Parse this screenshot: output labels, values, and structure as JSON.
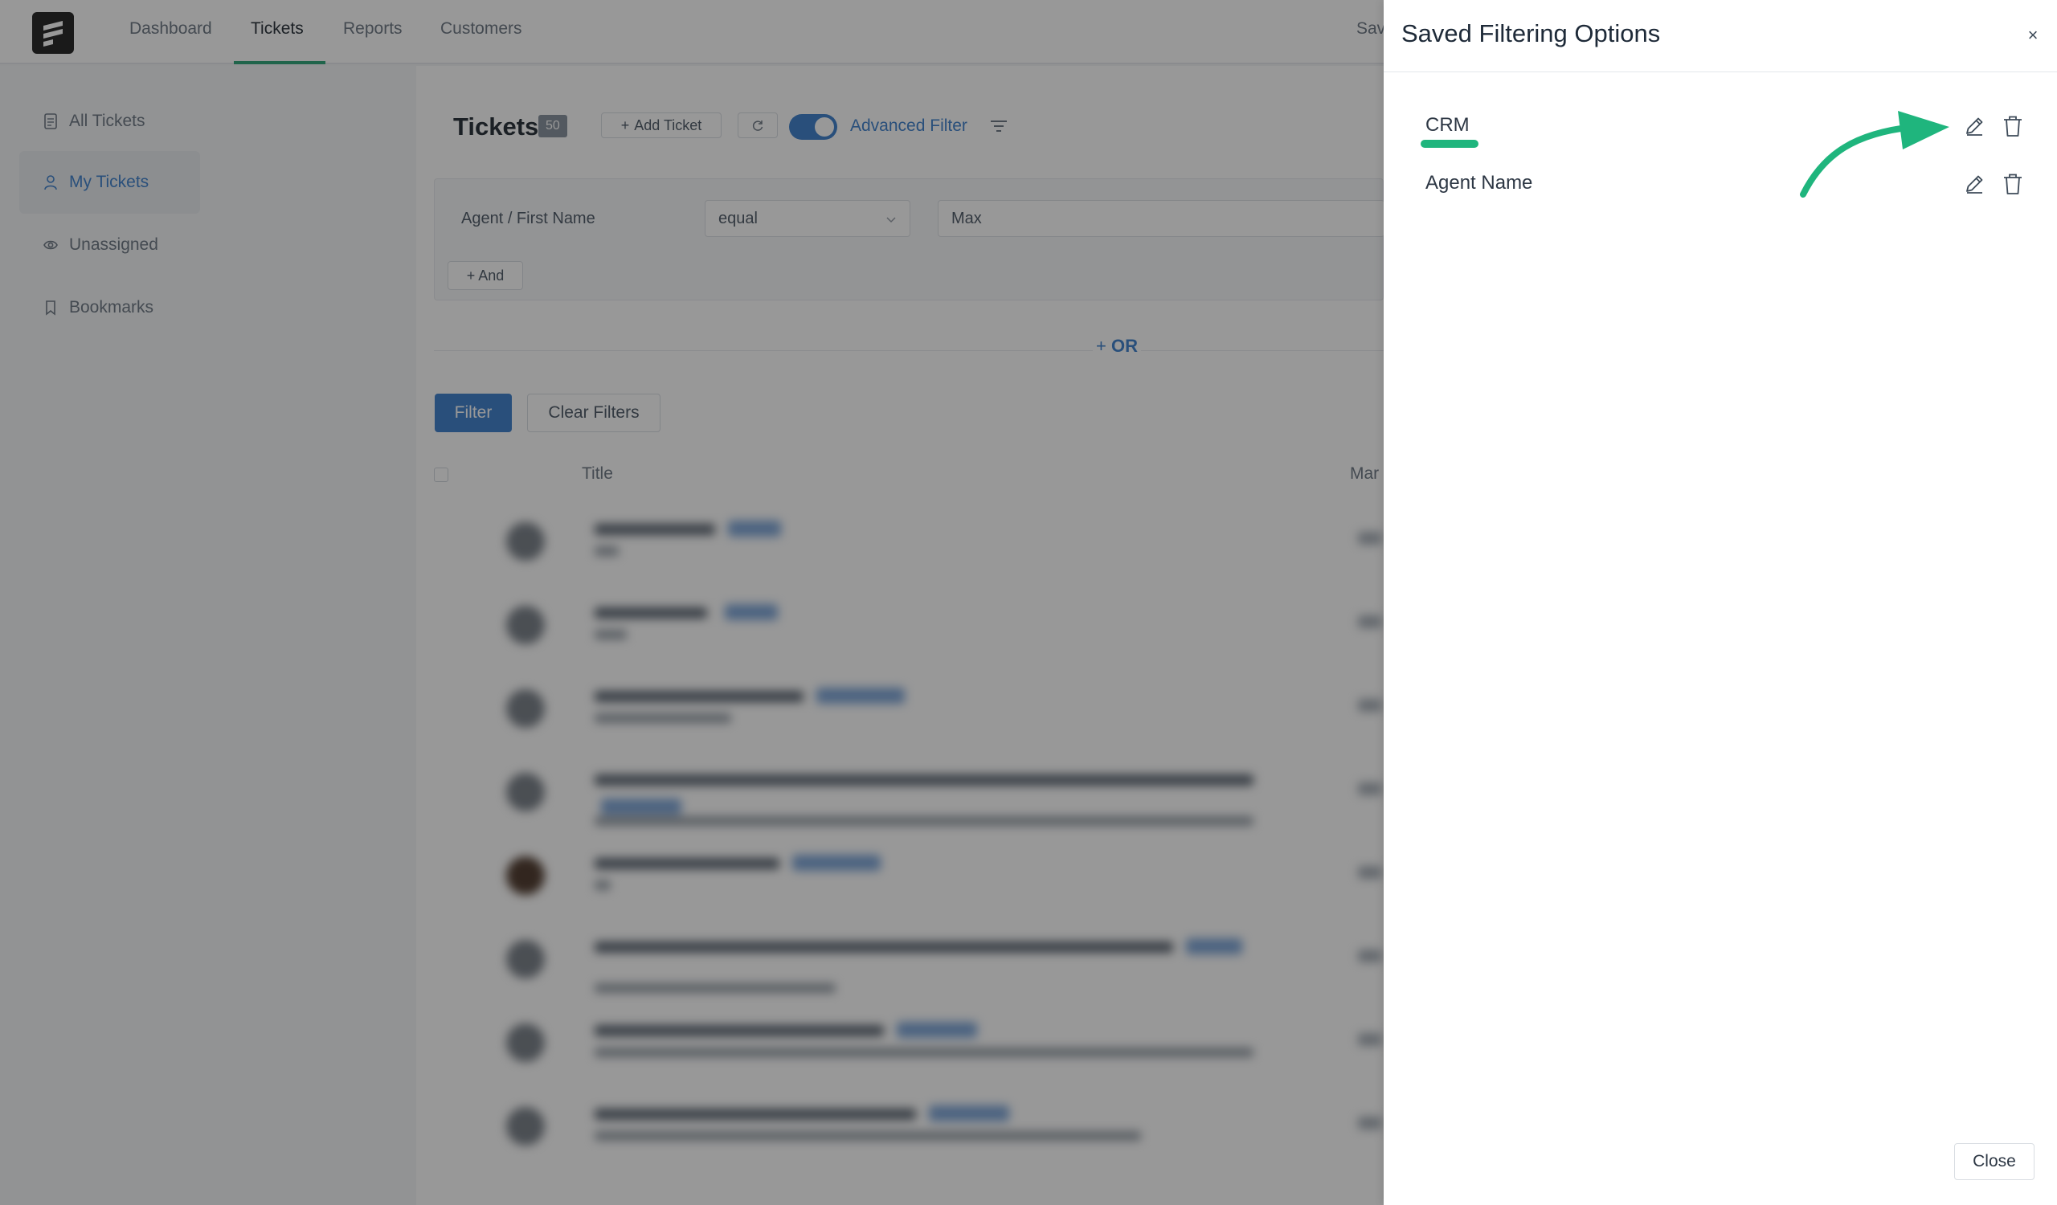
{
  "topbar": {
    "nav": [
      "Dashboard",
      "Tickets",
      "Reports",
      "Customers"
    ],
    "active_nav": "Tickets",
    "partial_right_text": "Sav"
  },
  "sidebar": {
    "items": [
      {
        "label": "All Tickets",
        "icon": "document-icon"
      },
      {
        "label": "My Tickets",
        "icon": "user-icon",
        "active": true
      },
      {
        "label": "Unassigned",
        "icon": "eye-icon"
      },
      {
        "label": "Bookmarks",
        "icon": "bookmark-icon"
      }
    ]
  },
  "main": {
    "title": "Tickets",
    "count": "50",
    "add_ticket_label": "Add Ticket",
    "advanced_filter_label": "Advanced Filter",
    "advanced_filter_on": true,
    "condition": {
      "field": "Agent / First Name",
      "operator": "equal",
      "value": "Max"
    },
    "and_label": "And",
    "or_label": "OR",
    "filter_label": "Filter",
    "clear_filters_label": "Clear Filters",
    "columns": [
      "Title",
      "Mar"
    ]
  },
  "drawer": {
    "title": "Saved Filtering Options",
    "close_x": "×",
    "items": [
      {
        "label": "CRM"
      },
      {
        "label": "Agent Name"
      }
    ],
    "close_label": "Close",
    "accent_color": "#1fb57d"
  },
  "colors": {
    "primary": "#2b74c7",
    "accent_green": "#1fb57d",
    "text": "#1e2a38"
  }
}
